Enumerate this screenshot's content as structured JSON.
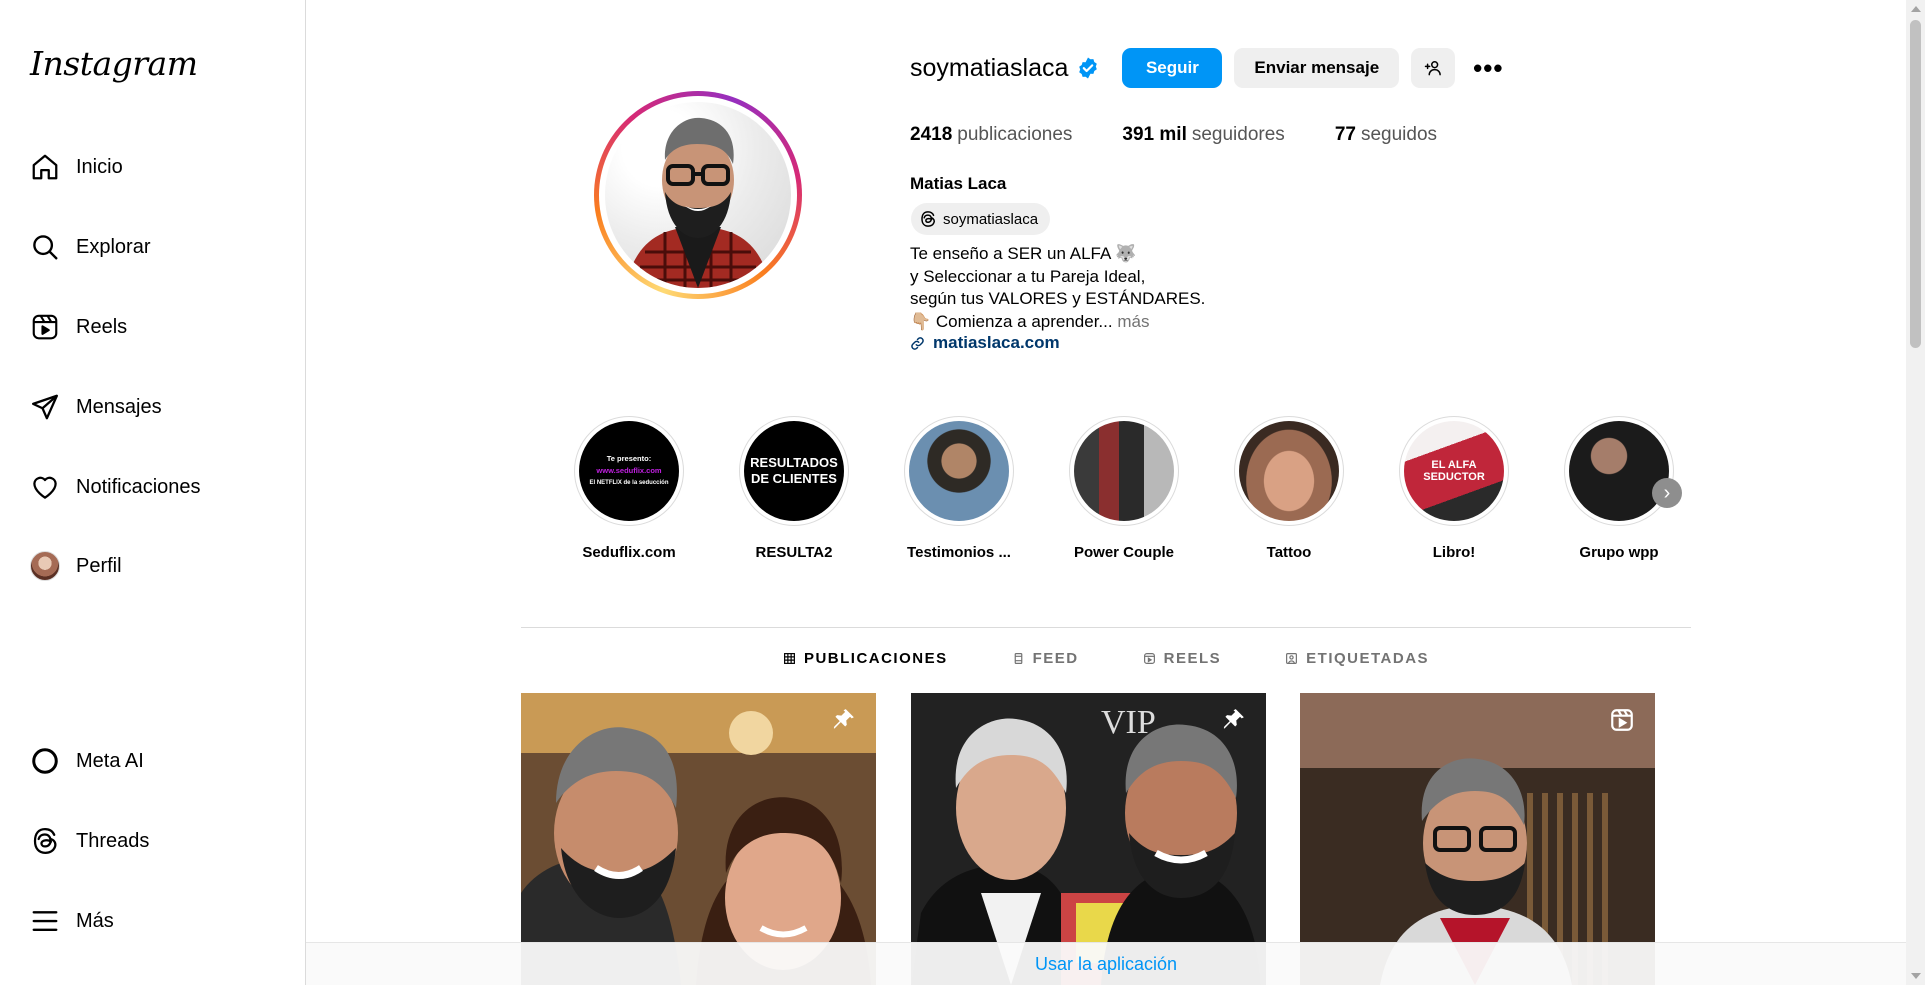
{
  "sidebar": {
    "logo": "Instagram",
    "items": [
      {
        "label": "Inicio",
        "icon": "home-icon"
      },
      {
        "label": "Explorar",
        "icon": "search-icon"
      },
      {
        "label": "Reels",
        "icon": "reels-icon"
      },
      {
        "label": "Mensajes",
        "icon": "send-icon"
      },
      {
        "label": "Notificaciones",
        "icon": "heart-icon"
      },
      {
        "label": "Perfil",
        "icon": "avatar"
      }
    ],
    "bottom_items": [
      {
        "label": "Meta AI",
        "icon": "meta-ai-icon"
      },
      {
        "label": "Threads",
        "icon": "threads-icon"
      },
      {
        "label": "Más",
        "icon": "menu-icon"
      }
    ]
  },
  "profile": {
    "username": "soymatiaslaca",
    "verified": true,
    "follow_label": "Seguir",
    "message_label": "Enviar mensaje",
    "stats": {
      "posts_count": "2418",
      "posts_label": "publicaciones",
      "followers_count": "391 mil",
      "followers_label": "seguidores",
      "following_count": "77",
      "following_label": "seguidos"
    },
    "full_name": "Matias Laca",
    "threads_handle": "soymatiaslaca",
    "bio_lines": [
      "Te enseño a SER un ALFA 🐺",
      "y Seleccionar a tu Pareja Ideal,",
      "según tus VALORES y ESTÁNDARES.",
      "👇🏼 Comienza a aprender..."
    ],
    "bio_more": "más",
    "link": "matiaslaca.com"
  },
  "highlights": [
    {
      "label": "Seduflix.com",
      "lines": [
        "Te presento:",
        "www.seduflix.com",
        "El NETFLIX de la seducción"
      ]
    },
    {
      "label": "RESULTA2",
      "lines": [
        "RESULTADOS",
        "DE CLIENTES"
      ]
    },
    {
      "label": "Testimonios ..."
    },
    {
      "label": "Power Couple"
    },
    {
      "label": "Tattoo"
    },
    {
      "label": "Libro!",
      "lines": [
        "EL ALFA",
        "SEDUCTOR"
      ]
    },
    {
      "label": "Grupo wpp"
    }
  ],
  "tabs": [
    {
      "label": "PUBLICACIONES",
      "icon": "grid-icon",
      "active": true
    },
    {
      "label": "FEED",
      "icon": "feed-icon",
      "active": false
    },
    {
      "label": "REELS",
      "icon": "reels-tab-icon",
      "active": false
    },
    {
      "label": "ETIQUETADAS",
      "icon": "tagged-icon",
      "active": false
    }
  ],
  "posts": [
    {
      "badge": "pin-icon"
    },
    {
      "badge": "pin-icon",
      "caption": "VIP"
    },
    {
      "badge": "reel-icon"
    }
  ],
  "app_bar": {
    "label": "Usar la aplicación"
  },
  "colors": {
    "primary": "#0095f6",
    "link": "#00376b",
    "muted": "#737373"
  }
}
